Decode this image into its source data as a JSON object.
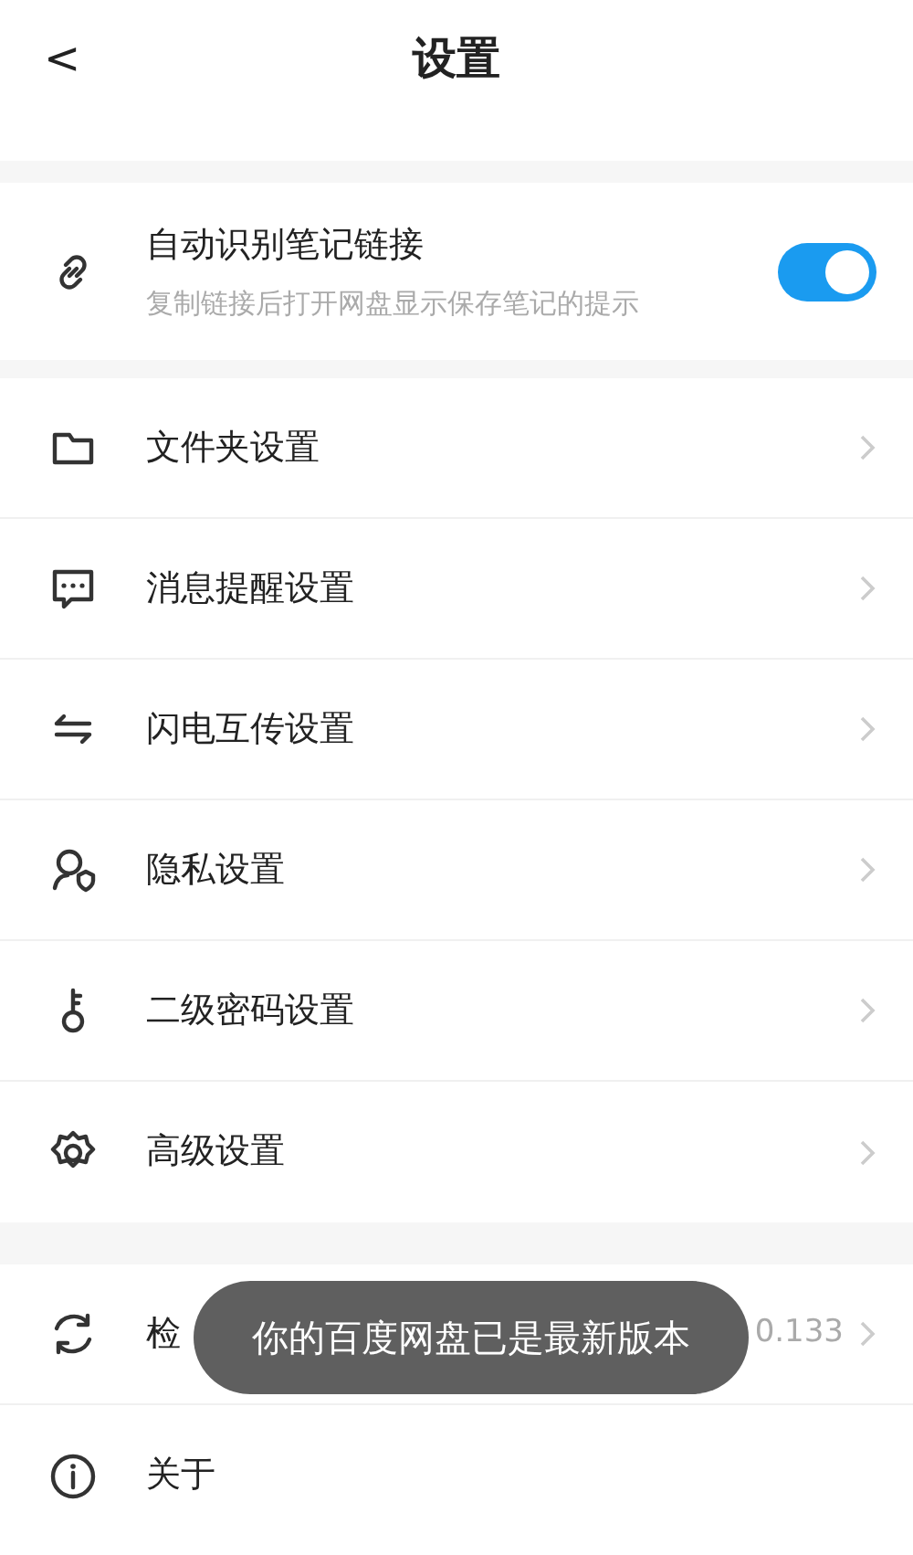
{
  "header": {
    "back": "<",
    "title": "设置"
  },
  "groups": [
    {
      "items": [
        {
          "kind": "toggle",
          "label": "自动识别笔记链接",
          "subtitle": "复制链接后打开网盘显示保存笔记的提示",
          "on": true
        }
      ]
    },
    {
      "items": [
        {
          "kind": "nav",
          "label": "文件夹设置"
        },
        {
          "kind": "nav",
          "label": "消息提醒设置"
        },
        {
          "kind": "nav",
          "label": "闪电互传设置"
        },
        {
          "kind": "nav",
          "label": "隐私设置"
        },
        {
          "kind": "nav",
          "label": "二级密码设置"
        },
        {
          "kind": "nav",
          "label": "高级设置"
        }
      ]
    },
    {
      "items": [
        {
          "kind": "nav",
          "label": "检",
          "value": "0.133"
        },
        {
          "kind": "plain",
          "label": "关于"
        }
      ]
    }
  ],
  "toast": "你的百度网盘已是最新版本"
}
